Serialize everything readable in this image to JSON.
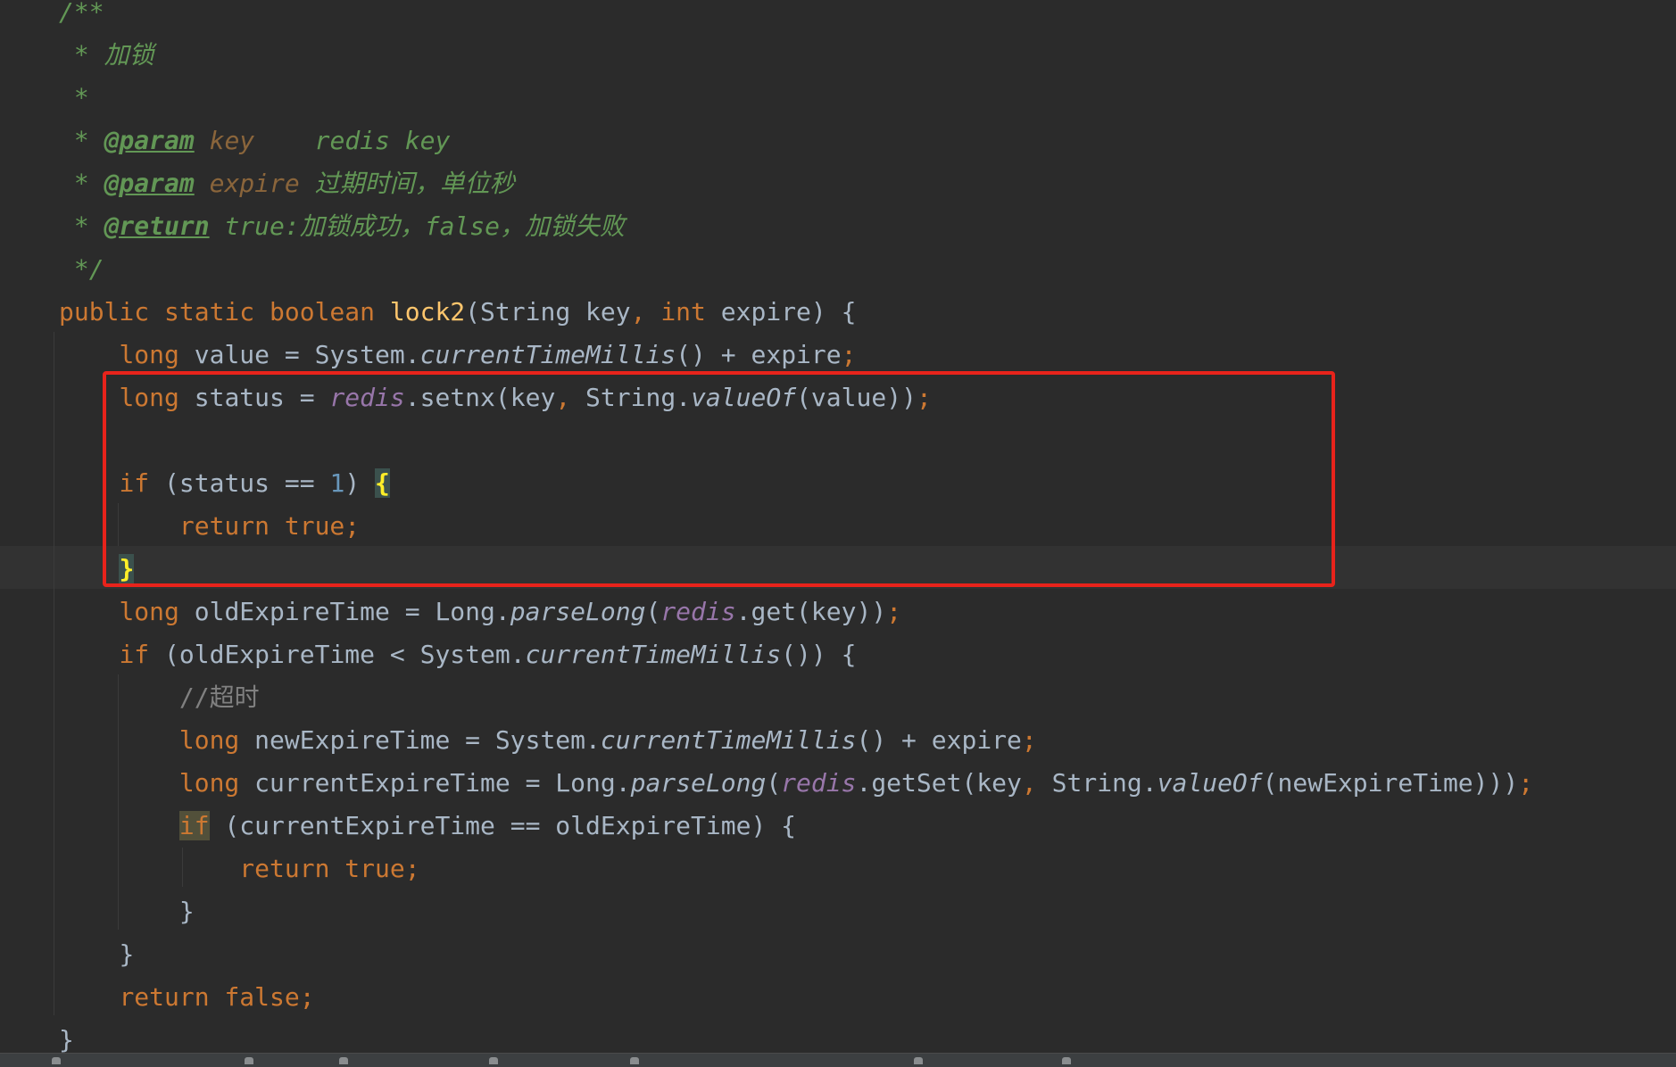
{
  "editor": {
    "language": "Java",
    "lines": [
      [
        {
          "t": "/**",
          "s": "doc"
        }
      ],
      [
        {
          "t": " * 加锁",
          "s": "doc"
        }
      ],
      [
        {
          "t": " *",
          "s": "doc"
        }
      ],
      [
        {
          "t": " * ",
          "s": "doc"
        },
        {
          "t": "@param",
          "s": "doc-tag"
        },
        {
          "t": " key",
          "s": "doc-param"
        },
        {
          "t": "    redis key",
          "s": "doc"
        }
      ],
      [
        {
          "t": " * ",
          "s": "doc"
        },
        {
          "t": "@param",
          "s": "doc-tag"
        },
        {
          "t": " expire",
          "s": "doc-param"
        },
        {
          "t": " 过期时间，单位秒",
          "s": "doc"
        }
      ],
      [
        {
          "t": " * ",
          "s": "doc"
        },
        {
          "t": "@return",
          "s": "doc-tag"
        },
        {
          "t": " true:加锁成功，false，加锁失败",
          "s": "doc"
        }
      ],
      [
        {
          "t": " */",
          "s": "doc"
        }
      ],
      [
        {
          "t": "public static boolean ",
          "s": "kw"
        },
        {
          "t": "lock2",
          "s": "fn"
        },
        {
          "t": "(String key",
          "s": "plain"
        },
        {
          "t": ", ",
          "s": "kw"
        },
        {
          "t": "int ",
          "s": "kw"
        },
        {
          "t": "expire) {",
          "s": "plain"
        }
      ],
      [
        {
          "t": "    "
        },
        {
          "t": "long ",
          "s": "kw"
        },
        {
          "t": "value = System.",
          "s": "plain"
        },
        {
          "t": "currentTimeMillis",
          "s": "italic"
        },
        {
          "t": "() + expire",
          "s": "plain"
        },
        {
          "t": ";",
          "s": "kw"
        }
      ],
      [
        {
          "t": "    "
        },
        {
          "t": "long ",
          "s": "kw"
        },
        {
          "t": "status = ",
          "s": "plain"
        },
        {
          "t": "redis",
          "s": "field"
        },
        {
          "t": ".setnx(key",
          "s": "plain"
        },
        {
          "t": ", ",
          "s": "kw"
        },
        {
          "t": "String.",
          "s": "plain"
        },
        {
          "t": "valueOf",
          "s": "italic"
        },
        {
          "t": "(value))",
          "s": "plain"
        },
        {
          "t": ";",
          "s": "kw"
        }
      ],
      [
        {
          "t": ""
        }
      ],
      [
        {
          "t": "    "
        },
        {
          "t": "if ",
          "s": "kw"
        },
        {
          "t": "(status == ",
          "s": "plain"
        },
        {
          "t": "1",
          "s": "num"
        },
        {
          "t": ") ",
          "s": "plain"
        },
        {
          "t": "{",
          "s": "brace-match"
        }
      ],
      [
        {
          "t": "        "
        },
        {
          "t": "return true;",
          "s": "kw"
        }
      ],
      [
        {
          "t": "    "
        },
        {
          "t": "}",
          "s": "brace-match"
        }
      ],
      [
        {
          "t": "    "
        },
        {
          "t": "long ",
          "s": "kw"
        },
        {
          "t": "oldExpireTime = Long.",
          "s": "plain"
        },
        {
          "t": "parseLong",
          "s": "italic"
        },
        {
          "t": "(",
          "s": "plain"
        },
        {
          "t": "redis",
          "s": "field"
        },
        {
          "t": ".get(key))",
          "s": "plain"
        },
        {
          "t": ";",
          "s": "kw"
        }
      ],
      [
        {
          "t": "    "
        },
        {
          "t": "if ",
          "s": "kw"
        },
        {
          "t": "(oldExpireTime < System.",
          "s": "plain"
        },
        {
          "t": "currentTimeMillis",
          "s": "italic"
        },
        {
          "t": "()) {",
          "s": "plain"
        }
      ],
      [
        {
          "t": "        "
        },
        {
          "t": "//超时",
          "s": "comment"
        }
      ],
      [
        {
          "t": "        "
        },
        {
          "t": "long ",
          "s": "kw"
        },
        {
          "t": "newExpireTime = System.",
          "s": "plain"
        },
        {
          "t": "currentTimeMillis",
          "s": "italic"
        },
        {
          "t": "() + expire",
          "s": "plain"
        },
        {
          "t": ";",
          "s": "kw"
        }
      ],
      [
        {
          "t": "        "
        },
        {
          "t": "long ",
          "s": "kw"
        },
        {
          "t": "currentExpireTime = Long.",
          "s": "plain"
        },
        {
          "t": "parseLong",
          "s": "italic"
        },
        {
          "t": "(",
          "s": "plain"
        },
        {
          "t": "redis",
          "s": "field"
        },
        {
          "t": ".getSet(key",
          "s": "plain"
        },
        {
          "t": ", ",
          "s": "kw"
        },
        {
          "t": "String.",
          "s": "plain"
        },
        {
          "t": "valueOf",
          "s": "italic"
        },
        {
          "t": "(newExpireTime)))",
          "s": "plain"
        },
        {
          "t": ";",
          "s": "kw"
        }
      ],
      [
        {
          "t": "        "
        },
        {
          "t": "if",
          "s": "kw hl-if"
        },
        {
          "t": " (currentExpireTime == oldExpireTime) {",
          "s": "plain"
        }
      ],
      [
        {
          "t": "            "
        },
        {
          "t": "return true;",
          "s": "kw"
        }
      ],
      [
        {
          "t": "        "
        },
        {
          "t": "}",
          "s": "plain"
        }
      ],
      [
        {
          "t": "    "
        },
        {
          "t": "}",
          "s": "plain"
        }
      ],
      [
        {
          "t": "    "
        },
        {
          "t": "return false;",
          "s": "kw"
        }
      ],
      [
        {
          "t": "}",
          "s": "plain"
        }
      ]
    ]
  },
  "colors": {
    "background": "#2b2b2b",
    "keyword": "#cc7832",
    "text": "#a9b7c6",
    "method_declaration": "#ffc66d",
    "number": "#6897bb",
    "field": "#9876aa",
    "doc_comment": "#629755",
    "comment": "#808080",
    "highlight_box": "#e8231b"
  },
  "annotation": {
    "type": "red-rectangle",
    "covers_lines": [
      9,
      10,
      11,
      12,
      13
    ]
  }
}
